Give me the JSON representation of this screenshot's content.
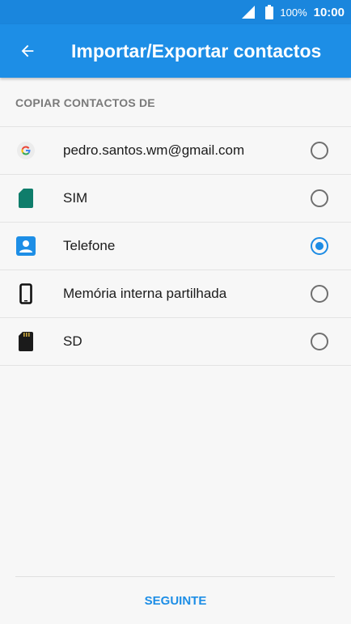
{
  "status_bar": {
    "battery": "100%",
    "time": "10:00",
    "icons": [
      "signal-icon",
      "battery-icon"
    ]
  },
  "app_bar": {
    "title": "Importar/Exportar contactos",
    "back_icon": "arrow-left-icon"
  },
  "section": {
    "header": "COPIAR CONTACTOS DE"
  },
  "options": [
    {
      "label": "pedro.santos.wm@gmail.com",
      "icon": "google-icon",
      "selected": false
    },
    {
      "label": "SIM",
      "icon": "sim-card-icon",
      "selected": false
    },
    {
      "label": "Telefone",
      "icon": "phone-contact-icon",
      "selected": true
    },
    {
      "label": "Memória interna partilhada",
      "icon": "smartphone-icon",
      "selected": false
    },
    {
      "label": "SD",
      "icon": "sd-card-icon",
      "selected": false
    }
  ],
  "footer": {
    "next_label": "SEGUINTE"
  },
  "colors": {
    "status_bar": "#1a86dd",
    "app_bar": "#1d8ee6",
    "accent": "#1c8be4",
    "sim_green": "#0f7d6b",
    "background": "#f7f7f7"
  }
}
